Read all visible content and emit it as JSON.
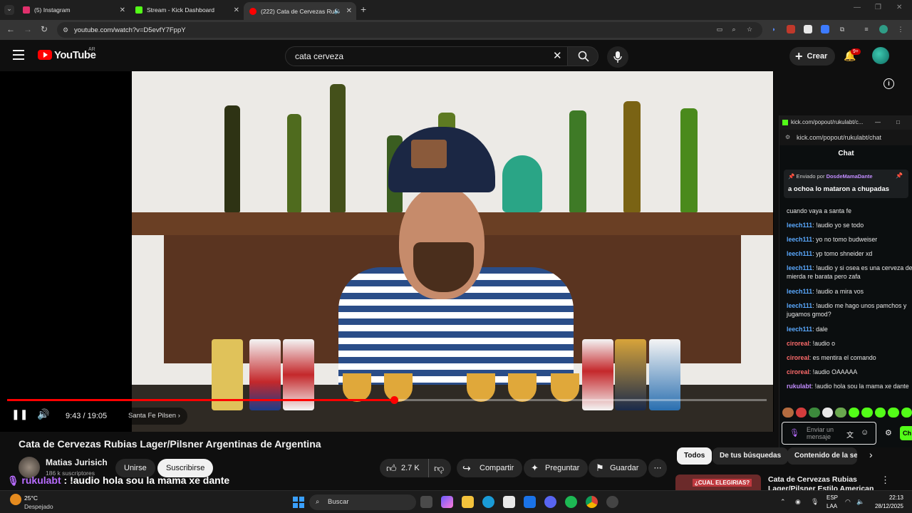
{
  "browser": {
    "tabs": [
      {
        "title": "(5) Instagram",
        "favicon_color": "#e1306c"
      },
      {
        "title": "Stream - Kick Dashboard",
        "favicon_color": "#53fc18"
      },
      {
        "title": "(222) Cata de Cervezas Rubi",
        "favicon_color": "#ff0000"
      }
    ],
    "new_tab_symbol": "+",
    "url": "youtube.com/watch?v=D5evfY7FppY"
  },
  "youtube": {
    "logo_text": "YouTube",
    "country_code": "AR",
    "search_value": "cata cerveza",
    "create_label": "Crear",
    "notifications_badge": "9+",
    "video": {
      "title": "Cata de Cervezas Rubias Lager/Pilsner Argentinas de Argentina",
      "time_display": "9:43 / 19:05",
      "chapter": "Santa Fe Pilsen",
      "progress_fraction": 0.509
    },
    "channel": {
      "name": "Matias Jurisich",
      "subscribers": "186 k suscriptores",
      "join_label": "Unirse",
      "subscribe_label": "Suscribirse"
    },
    "actions": {
      "likes": "2.7 K",
      "share_label": "Compartir",
      "ask_label": "Preguntar",
      "save_label": "Guardar"
    },
    "filters": [
      "Todos",
      "De tus búsquedas",
      "Contenido de la se"
    ],
    "recommendation": {
      "badge": "¿CUAL ELEGIRIAS?",
      "title": "Cata de Cervezas Rubias Lager/Pilsner Estilo American"
    },
    "overlay": {
      "user": "rukulabt",
      "message": " : !audio hola sou la mama xe dante"
    }
  },
  "kick_popout": {
    "window_title": "kick.com/popout/rukulabt/c...",
    "url": "kick.com/popout/rukulabt/chat",
    "chat_header": "Chat",
    "pinned": {
      "sent_by_label": "Enviado por",
      "sender": "DosdeMamaDante",
      "message": "a ochoa lo mataron a chupadas"
    },
    "messages": [
      {
        "user": "",
        "text": "cuando vaya a santa fe",
        "color": "#e6e6e6"
      },
      {
        "user": "leech111",
        "text": ": !audio yo se todo",
        "color": "#5aa9ff"
      },
      {
        "user": "leech111",
        "text": ": yo no tomo budweiser",
        "color": "#5aa9ff"
      },
      {
        "user": "leech111",
        "text": ": yp tomo shneider xd",
        "color": "#5aa9ff"
      },
      {
        "user": "leech111",
        "text": ": !audio y si osea es una cerveza de mierda re barata pero zafa",
        "color": "#5aa9ff"
      },
      {
        "user": "leech111",
        "text": ": !audio a mira vos",
        "color": "#5aa9ff"
      },
      {
        "user": "leech111",
        "text": ": !audio me hago unos pamchos y jugamos gmod?",
        "color": "#5aa9ff"
      },
      {
        "user": "leech111",
        "text": ": dale",
        "color": "#5aa9ff"
      },
      {
        "user": "ciroreal",
        "text": ": !audio o",
        "color": "#ff6b6b"
      },
      {
        "user": "ciroreal",
        "text": ": es mentira el comando",
        "color": "#ff6b6b"
      },
      {
        "user": "ciroreal",
        "text": ": !audio OAAAAA",
        "color": "#ff6b6b"
      },
      {
        "user": "rukulabt",
        "text": ": !audio hola sou la mama xe dante",
        "color": "#c28cff"
      }
    ],
    "input_placeholder": "Enviar un mensaje",
    "send_label": "Ch"
  },
  "taskbar": {
    "temperature": "25°C",
    "weather": "Despejado",
    "search_label": "Buscar",
    "lang_1": "ESP",
    "lang_2": "LAA",
    "time": "22:13",
    "date": "28/12/2025"
  }
}
